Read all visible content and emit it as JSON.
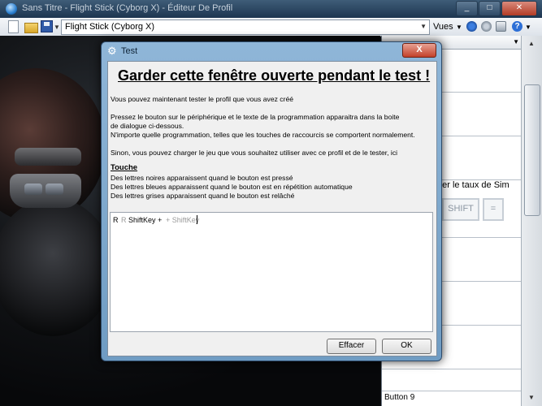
{
  "window": {
    "title": "Sans Titre - Flight Stick (Cyborg X) - Éditeur De Profil",
    "minimize": "_",
    "maximize": "□",
    "close": "✕"
  },
  "toolbar": {
    "profile_value": "Flight Stick (Cyborg X)",
    "views_label": "Vues",
    "dropdown_arrow": "▼",
    "help_label": "?"
  },
  "right_panel": {
    "header_text": "",
    "description_fragment": "irer le taux de Sim",
    "key_shift": "SHIFT",
    "key_equals": "=",
    "bottom_label": "Button 9",
    "scroll_up": "▲",
    "scroll_down": "▼"
  },
  "dialog": {
    "title": "Test",
    "gear_glyph": "⚙",
    "close": "X",
    "heading": "Garder cette fenêtre ouverte pendant le test !",
    "line1": "Vous pouvez maintenant tester le profil que vous avez créé",
    "line2": "Pressez le bouton sur le périphérique et le texte de la programmation apparaitra dans la boite",
    "line3": "de dialogue ci-dessous.",
    "line4": "N'importe quelle programmation, telles que les touches de raccourcis se comportent normalement.",
    "line5": "Sinon, vous pouvez charger le jeu que vous souhaitez utiliser avec ce profil et de le tester, ici",
    "key_title": "Touche",
    "key1": "Des lettres noires apparaissent quand le bouton est pressé",
    "key2": "Des lettres bleues apparaissent quand le bouton est en répétition automatique",
    "key3": "Des lettres grises apparaissent quand le bouton est relâché",
    "output": {
      "r_pressed": "R",
      "r_released": "R",
      "shift_pressed": "ShiftKey +",
      "shift_released": "+ ShiftKey"
    },
    "btn_clear": "Effacer",
    "btn_ok": "OK"
  },
  "colors": {
    "pressed": "#000000",
    "released": "#9a9a9a",
    "dialog_frame": "#8fb6d8",
    "close_button": "#c3412a"
  }
}
